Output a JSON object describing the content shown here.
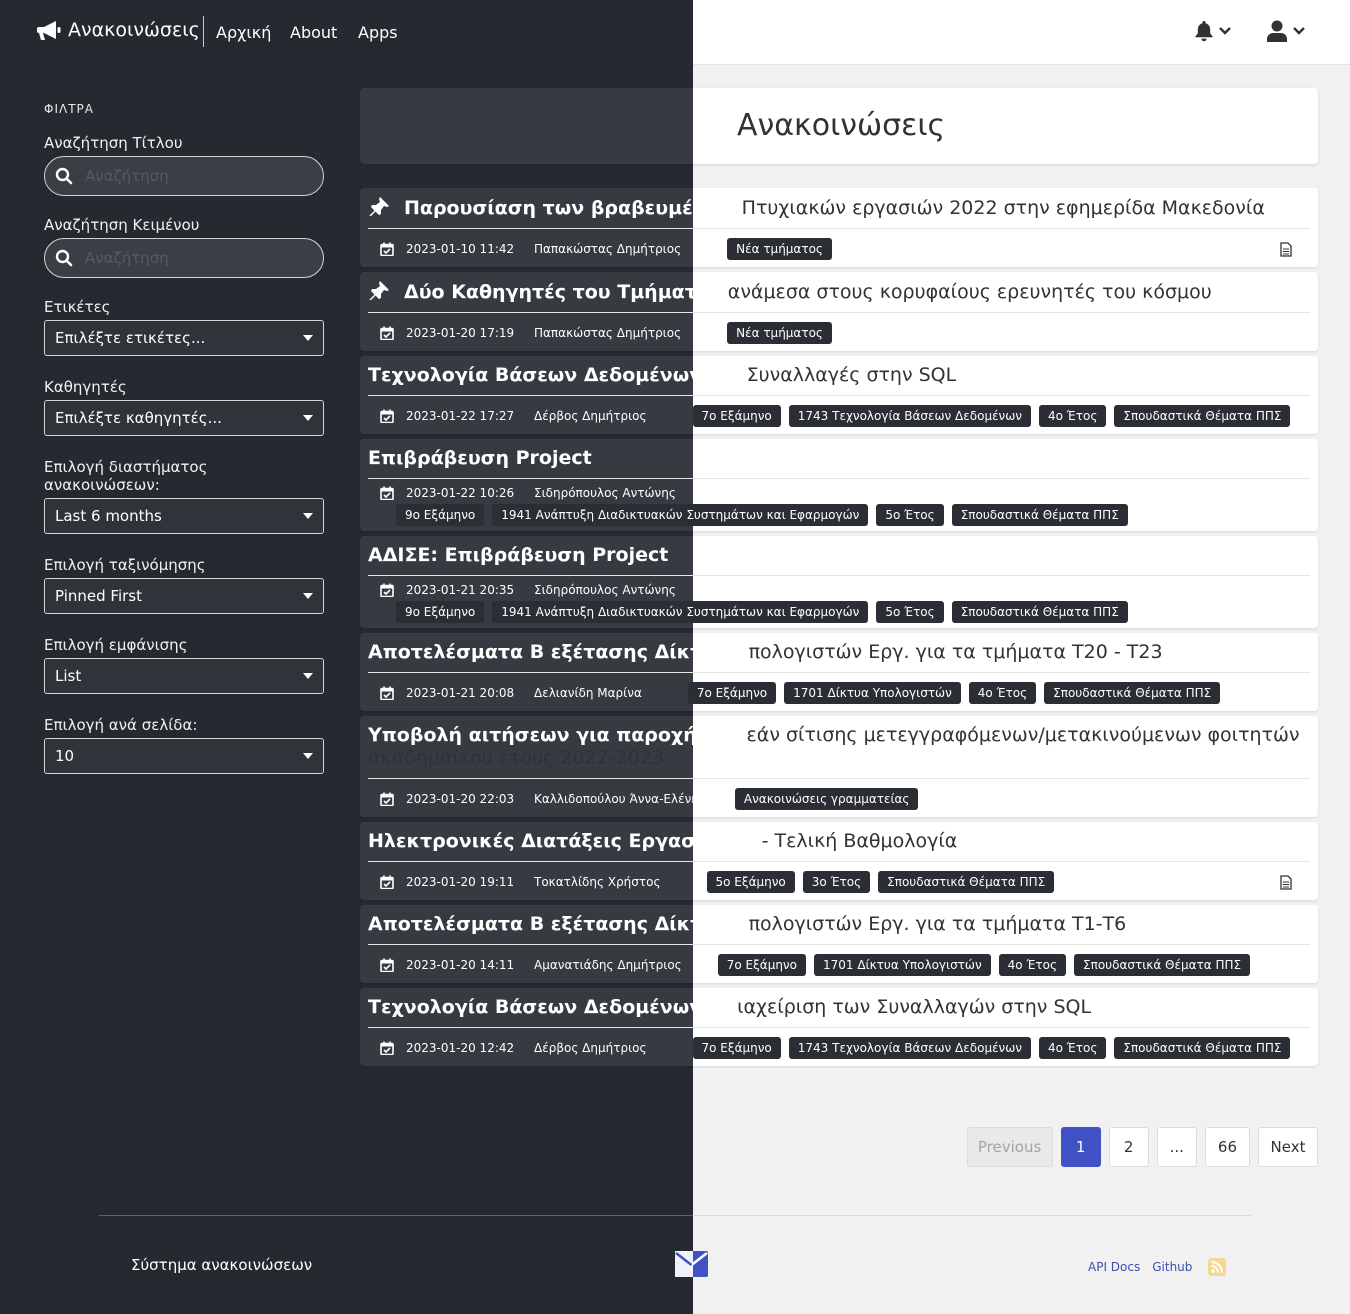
{
  "nav": {
    "brand": "Ανακοινώσεις",
    "links": [
      "Αρχική",
      "About",
      "Apps"
    ],
    "icons": [
      "megaphone-icon",
      "bell-icon",
      "user-icon"
    ]
  },
  "sidebar": {
    "title": "ΦΙΛΤΡΑ",
    "title_search_label": "Αναζήτηση Τίτλου",
    "title_search_placeholder": "Αναζήτηση",
    "text_search_label": "Αναζήτηση Κειμένου",
    "text_search_placeholder": "Αναζήτηση",
    "tags_label": "Ετικέτες",
    "tags_value": "Επιλέξτε ετικέτες...",
    "profs_label": "Καθηγητές",
    "profs_value": "Επιλέξτε καθηγητές...",
    "range_label": "Επιλογή διαστήματος ανακοινώσεων:",
    "range_value": "Last 6 months",
    "sort_label": "Επιλογή ταξινόμησης",
    "sort_value": "Pinned First",
    "view_label": "Επιλογή εμφάνισης",
    "view_value": "List",
    "perpage_label": "Επιλογή ανά σελίδα:",
    "perpage_value": "10"
  },
  "main": {
    "heading": "Ανακοινώσεις",
    "announcements": [
      {
        "title_a": "Παρουσίαση των βραβευμένων ",
        "title_b": "Πτυχιακών εργασιών 2022 στην εφημερίδα Μακεδονία",
        "pinned": true,
        "date": "2023-01-10 11:42",
        "author": "Παπακώστας Δημήτριος",
        "tags": [
          "Νέα τμήματος"
        ],
        "attachment": true
      },
      {
        "title_a": "Δύο Καθηγητές του Τμήματος ",
        "title_b": "ανάμεσα στους κορυφαίους ερευνητές του κόσμου",
        "pinned": true,
        "date": "2023-01-20 17:19",
        "author": "Παπακώστας Δημήτριος",
        "tags": [
          "Νέα τμήματος"
        ],
        "attachment": false
      },
      {
        "title_a": "Τεχνολογία Βάσεων Δεδομένων: Οι ",
        "title_b": "Συναλλαγές στην SQL",
        "pinned": false,
        "date": "2023-01-22 17:27",
        "author": "Δέρβος Δημήτριος",
        "tags": [
          "7ο Εξάμηνο",
          "1743 Τεχνολογία Βάσεων Δεδομένων",
          "4ο Έτος",
          "Σπουδαστικά Θέματα ΠΠΣ"
        ],
        "attachment": false
      },
      {
        "title_a": "Επιβράβευση Project",
        "title_b": "",
        "pinned": false,
        "date": "2023-01-22 10:26",
        "author": "Σιδηρόπουλος Αντώνης",
        "tags": [
          "9ο Εξάμηνο",
          "1941 Ανάπτυξη Διαδικτυακών Συστημάτων και Εφαρμογών",
          "5ο Έτος",
          "Σπουδαστικά Θέματα ΠΠΣ"
        ],
        "attachment": false
      },
      {
        "title_a": "ΑΔΙΣΕ: Επιβράβευση Project",
        "title_b": "",
        "pinned": false,
        "date": "2023-01-21 20:35",
        "author": "Σιδηρόπουλος Αντώνης",
        "tags": [
          "9ο Εξάμηνο",
          "1941 Ανάπτυξη Διαδικτυακών Συστημάτων και Εφαρμογών",
          "5ο Έτος",
          "Σπουδαστικά Θέματα ΠΠΣ"
        ],
        "attachment": false
      },
      {
        "title_a": "Αποτελέσματα Β εξέτασης Δίκτυα Υ",
        "title_b": "πολογιστών Εργ. για τα τμήματα Τ20 - Τ23",
        "pinned": false,
        "date": "2023-01-21 20:08",
        "author": "Δελιανίδη Μαρίνα",
        "tags": [
          "7ο Εξάμηνο",
          "1701 Δίκτυα Υπολογιστών",
          "4ο Έτος",
          "Σπουδαστικά Θέματα ΠΠΣ"
        ],
        "attachment": false
      },
      {
        "title_a": "Υποβολή αιτήσεων για παροχή δωρ",
        "title_b": "εάν σίτισης μετεγγραφόμενων/μετακινούμενων φοιτητών ακαδημαϊκού έτους 2022-2023",
        "pinned": false,
        "date": "2023-01-20 22:03",
        "author": "Καλλιδοπούλου Άννα-Ελένη",
        "tags": [
          "Ανακοινώσεις γραμματείας"
        ],
        "attachment": false
      },
      {
        "title_a": "Ηλεκτρονικές Διατάξεις Εργαστήριο",
        "title_b": " - Τελική Βαθμολογία",
        "pinned": false,
        "date": "2023-01-20 19:11",
        "author": "Τοκατλίδης Χρήστος",
        "tags": [
          "5ο Εξάμηνο",
          "3ο Έτος",
          "Σπουδαστικά Θέματα ΠΠΣ"
        ],
        "attachment": true
      },
      {
        "title_a": "Αποτελέσματα Β εξέτασης Δίκτυα Υ",
        "title_b": "πολογιστών Εργ. για τα τμήματα Τ1-Τ6",
        "pinned": false,
        "date": "2023-01-20 14:11",
        "author": "Αμανατιάδης Δημήτριος",
        "tags": [
          "7ο Εξάμηνο",
          "1701 Δίκτυα Υπολογιστών",
          "4ο Έτος",
          "Σπουδαστικά Θέματα ΠΠΣ"
        ],
        "attachment": false
      },
      {
        "title_a": "Τεχνολογία Βάσεων Δεδομένων / Δ",
        "title_b": "ιαχείριση των Συναλλαγών στην SQL",
        "pinned": false,
        "date": "2023-01-20 12:42",
        "author": "Δέρβος Δημήτριος",
        "tags": [
          "7ο Εξάμηνο",
          "1743 Τεχνολογία Βάσεων Δεδομένων",
          "4ο Έτος",
          "Σπουδαστικά Θέματα ΠΠΣ"
        ],
        "attachment": false
      }
    ]
  },
  "pagination": {
    "previous": "Previous",
    "pages": [
      "1",
      "2",
      "...",
      "66"
    ],
    "active": "1",
    "next": "Next"
  },
  "footer": {
    "text": "Σύστημα ανακοινώσεων",
    "links": [
      "API Docs",
      "Github"
    ],
    "icons": [
      "mail-icon",
      "rss-icon"
    ]
  },
  "colors": {
    "dark_bg": "#252a31",
    "card_dark": "#363b42",
    "accent": "#3f51c5",
    "tag_bg": "#2b2f35"
  }
}
